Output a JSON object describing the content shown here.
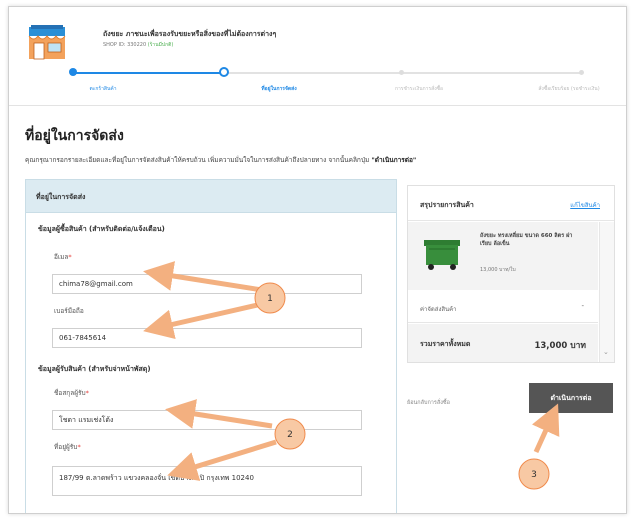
{
  "header": {
    "shop_name": "ถังขยะ ภาชนะเพื่อรองรับขยะหรือสิ่งของที่ไม่ต้องการต่างๆ",
    "shop_id": "SHOP ID: 330220",
    "shop_note": "(ร้านมีปกติ)"
  },
  "stepper": {
    "steps": [
      {
        "label": "ตะกร้าสินค้า",
        "state": "done"
      },
      {
        "label": "ที่อยู่ในการจัดส่ง",
        "state": "current"
      },
      {
        "label": "การชำระเงินการสั่งซื้อ",
        "state": "pending"
      },
      {
        "label": "สั่งซื้อเรียบร้อย (รอชำระเงิน)",
        "state": "pending"
      }
    ]
  },
  "page": {
    "title": "ที่อยู่ในการจัดส่ง",
    "intro_text": "คุณกรุณากรอกรายละเอียดและที่อยู่ในการจัดส่งสินค้าให้ครบถ้วน เพิ่มความมั่นใจในการส่งสินค้าถึงปลายทาง จากนั้นคลิกปุ่ม",
    "intro_button_ref": "\"ดำเนินการต่อ\""
  },
  "form": {
    "panel_title": "ที่อยู่ในการจัดส่ง",
    "buyer_section": "ข้อมูลผู้ซื้อสินค้า (สำหรับติดต่อ/แจ้งเตือน)",
    "email_label": "อีเมล",
    "email_value": "chima78@gmail.com",
    "phone_label": "เบอร์มือถือ",
    "phone_value": "061-7845614",
    "receiver_section": "ข้อมูลผู้รับสินค้า (สำหรับจ่าหน้าพัสดุ)",
    "name_label": "ชื่อสกุลผู้รับ",
    "name_value": "โชดา แรมเช่งโต้ง",
    "address_label": "ที่อยู่ผู้รับ",
    "address_value": "187/99 ต.ลาดพร้าว แขวงคลองจั่น เขตบางกะปิ กรุงเทพ 10240",
    "required_mark": "*"
  },
  "summary": {
    "title": "สรุปรายการสินค้า",
    "edit_link": "แก้ไขสินค้า",
    "item_name": "ถังขยะ ทรงเหลี่ยม ขนาด 660 ลิตร ฝาเรียบ ล้อเข็น",
    "item_price": "13,000 บาท/ใบ",
    "shipping_label": "ค่าจัดส่งสินค้า",
    "shipping_value": "-",
    "total_label": "รวมราคาทั้งหมด",
    "total_value": "13,000 บาท"
  },
  "actions": {
    "back_link": "ย้อนกลับการสั่งซื้อ",
    "continue_button": "ดำเนินการต่อ"
  },
  "annotations": {
    "markers": [
      "1",
      "2",
      "3"
    ]
  },
  "colors": {
    "accent_blue": "#1e88e5",
    "panel_header": "#dcebf2",
    "button_dark": "#555555",
    "annotation_fill": "#f8c9a4",
    "annotation_stroke": "#f08a4b",
    "bin_green": "#2e7d32"
  }
}
